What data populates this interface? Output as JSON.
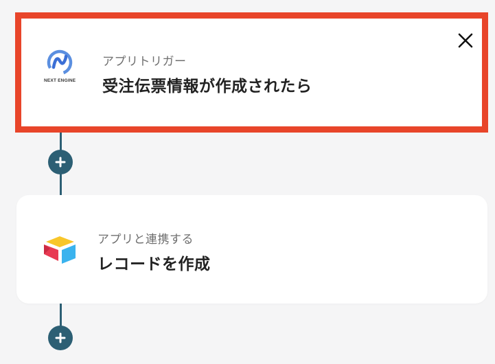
{
  "flow": {
    "steps": [
      {
        "subtitle": "アプリトリガー",
        "title": "受注伝票情報が作成されたら",
        "app_icon": "next-engine-logo",
        "logo_text": "NEXT ENGINE",
        "selected": true
      },
      {
        "subtitle": "アプリと連携する",
        "title": "レコードを作成",
        "app_icon": "airtable-logo",
        "selected": false
      }
    ],
    "close_icon": "close-icon",
    "add_icon": "plus-icon"
  },
  "colors": {
    "selected_border": "#e8452a",
    "connector": "#2c5f74",
    "background": "#f5f5f6"
  }
}
